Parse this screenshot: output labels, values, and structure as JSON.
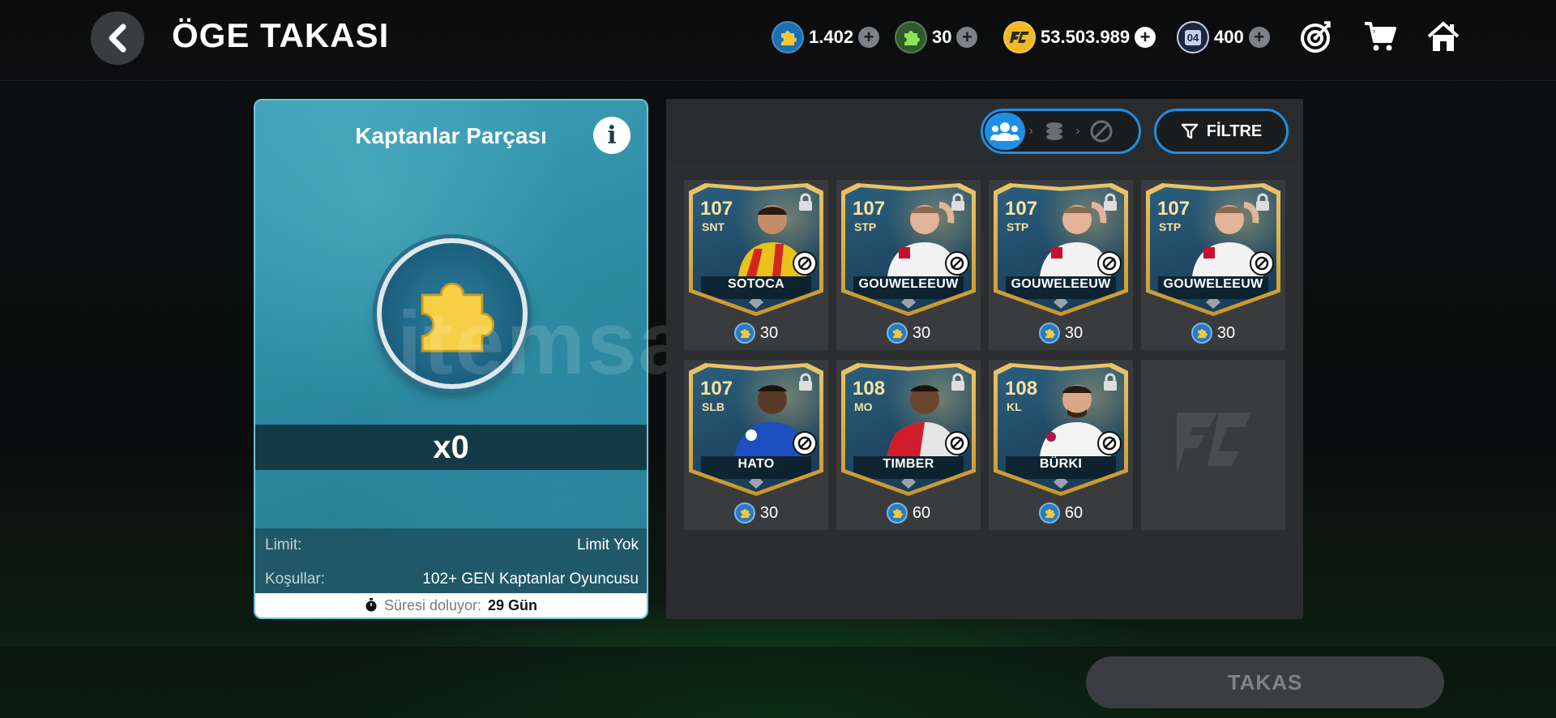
{
  "header": {
    "title": "ÖGE TAKASI",
    "currencies": [
      {
        "icon": "captains-piece-icon",
        "value": "1.402"
      },
      {
        "icon": "green-piece-icon",
        "value": "30"
      },
      {
        "icon": "fc-coin-icon",
        "value": "53.503.989"
      },
      {
        "icon": "gem-card-icon",
        "badge": "04",
        "value": "400"
      }
    ]
  },
  "item": {
    "name": "Kaptanlar Parçası",
    "count": "x0",
    "limit_label": "Limit:",
    "limit_value": "Limit Yok",
    "conditions_label": "Koşullar:",
    "conditions_value": "102+ GEN Kaptanlar Oyuncusu",
    "expire_label": "Süresi doluyor:",
    "expire_value": "29 Gün"
  },
  "filter": {
    "label": "FİLTRE"
  },
  "players": [
    {
      "rating": "107",
      "position": "SNT",
      "name": "SOTOCA",
      "price": "30",
      "kit": "lens"
    },
    {
      "rating": "107",
      "position": "STP",
      "name": "GOUWELEEUW",
      "price": "30",
      "kit": "augsburg"
    },
    {
      "rating": "107",
      "position": "STP",
      "name": "GOUWELEEUW",
      "price": "30",
      "kit": "augsburg"
    },
    {
      "rating": "107",
      "position": "STP",
      "name": "GOUWELEEUW",
      "price": "30",
      "kit": "augsburg"
    },
    {
      "rating": "107",
      "position": "SLB",
      "name": "HATO",
      "price": "30",
      "kit": "chelsea"
    },
    {
      "rating": "108",
      "position": "MO",
      "name": "TIMBER",
      "price": "60",
      "kit": "feyenoord"
    },
    {
      "rating": "108",
      "position": "KL",
      "name": "BÜRKI",
      "price": "60",
      "kit": "stlouis"
    }
  ],
  "swap_button": "TAKAS",
  "watermark": "itemsatış"
}
